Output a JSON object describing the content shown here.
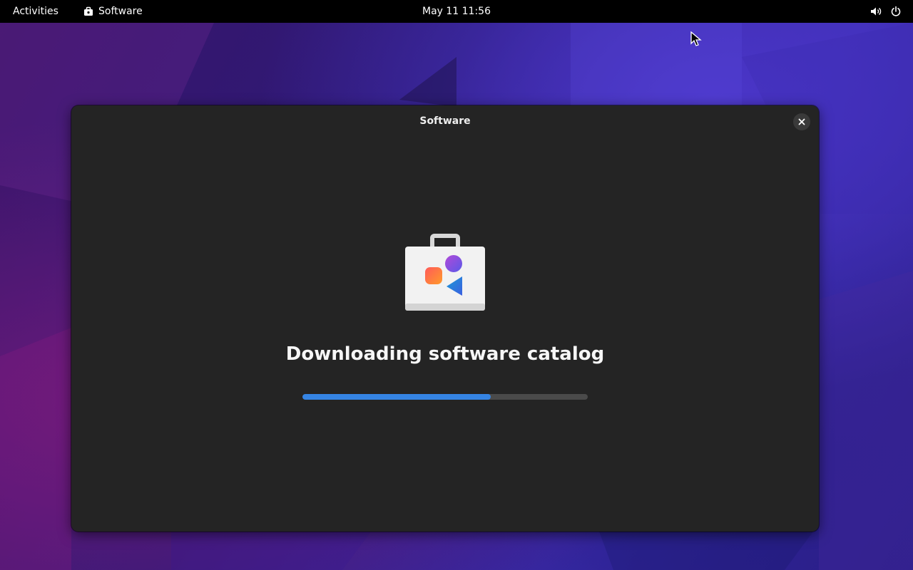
{
  "topbar": {
    "activities_label": "Activities",
    "app_name": "Software",
    "clock": "May 11  11:56",
    "icons": {
      "app": "software-bag-icon",
      "volume": "volume-icon",
      "power": "power-icon"
    }
  },
  "window": {
    "title": "Software",
    "close_icon": "close-icon",
    "status_heading": "Downloading software catalog",
    "progress_fraction": 0.66
  },
  "colors": {
    "topbar_bg": "#000000",
    "window_bg": "#242424",
    "progress_fill": "#3584e4",
    "progress_track": "#4a4a4a"
  }
}
